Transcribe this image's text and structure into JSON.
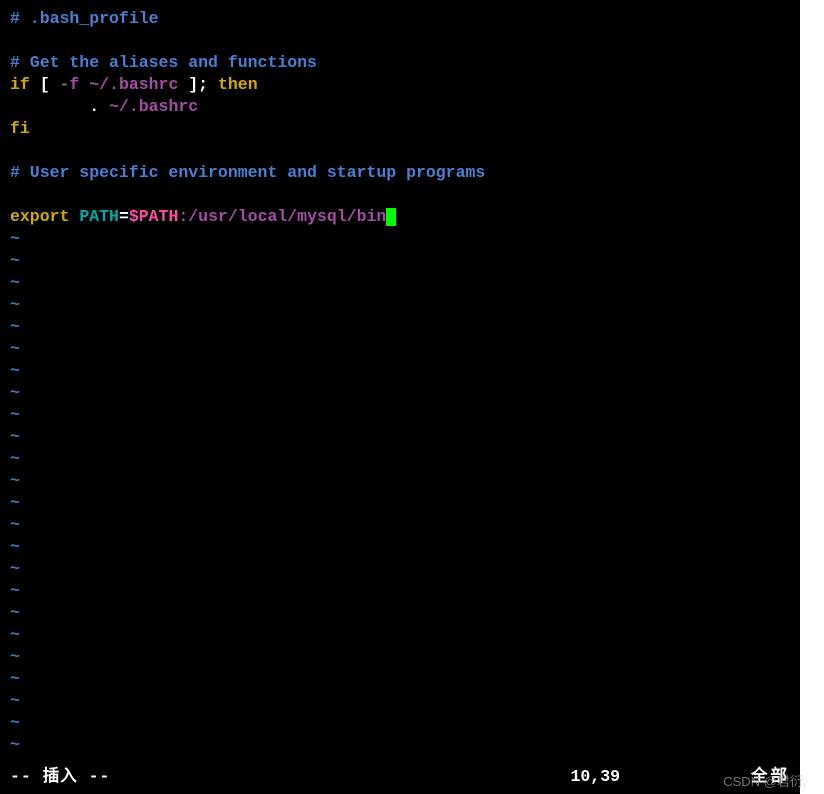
{
  "content": {
    "line1_comment": "# .bash_profile",
    "line3_comment": "# Get the aliases and functions",
    "line4_if": "if",
    "line4_bracket_open": " [ ",
    "line4_flag": "-f",
    "line4_path": " ~/.bashrc ",
    "line4_bracket_close": "]; ",
    "line4_then": "then",
    "line5_indent": "        . ",
    "line5_path": "~/.bashrc",
    "line6_fi": "fi",
    "line8_comment": "# User specific environment and startup programs",
    "line10_export": "export",
    "line10_space": " ",
    "line10_var": "PATH",
    "line10_eq": "=",
    "line10_varexp": "$PATH",
    "line10_path": ":/usr/local/mysql/bin"
  },
  "empty_marker": "~",
  "status": {
    "mode": "-- 插入 --",
    "position": "10,39",
    "scope": "全部"
  },
  "watermark": "CSDN @君衍.⠀",
  "colors": {
    "comment": "#4b7fd4",
    "keyword": "#d4aa00",
    "builtin": "#00aaaa",
    "variable": "#00aaaa",
    "varexpand": "#ff4da6",
    "path": "#a64ca6",
    "tilde": "#3a7bbf",
    "cursor": "#00ff00"
  }
}
